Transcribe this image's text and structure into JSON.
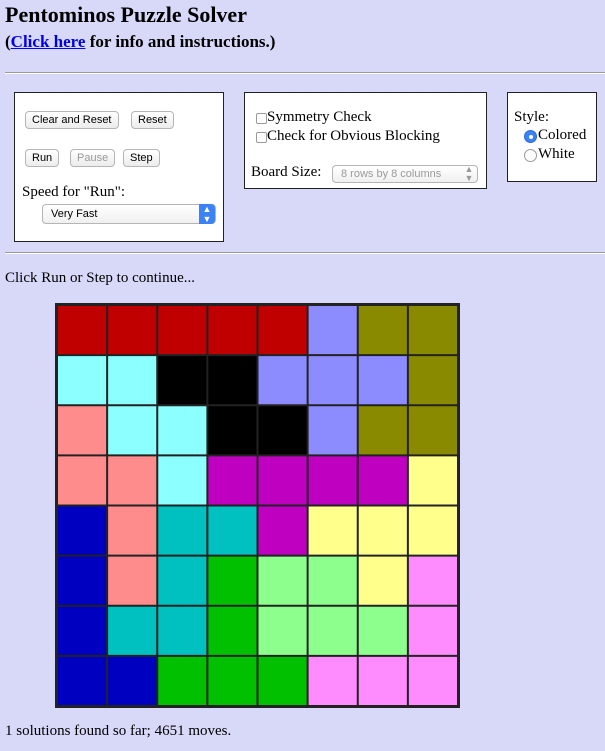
{
  "header": {
    "title": "Pentominos Puzzle Solver",
    "info_link": "Click here",
    "info_rest": " for info and instructions.)"
  },
  "controls": {
    "clear_reset": "Clear and Reset",
    "reset": "Reset",
    "run": "Run",
    "pause": "Pause",
    "step": "Step",
    "speed_label": "Speed for \"Run\":",
    "speed_value": "Very Fast"
  },
  "options": {
    "symmetry_check": "Symmetry Check",
    "blocking_check": "Check for Obvious Blocking",
    "board_size_label": "Board Size:",
    "board_size_value": "8 rows by 8 columns"
  },
  "style": {
    "label": "Style:",
    "colored": "Colored",
    "white": "White",
    "selected": "Colored"
  },
  "status": {
    "message": "Click Run or Step to continue...",
    "result": "1 solutions found so far; 4651 moves."
  },
  "board": {
    "rows": 8,
    "cols": 8,
    "colors": {
      "A": "#c00000",
      "B": "#8c8cff",
      "C": "#8a8a00",
      "D": "#8cffff",
      "E": "#000000",
      "F": "#ff8c8c",
      "G": "#c000c0",
      "H": "#ffff8c",
      "I": "#0000c0",
      "J": "#00c0c0",
      "K": "#00c000",
      "L": "#8cff8c",
      "M": "#ff8cff"
    },
    "cells": [
      "AAAAABCC",
      "DDEEBBBC",
      "FDDEEBCC",
      "FFDGGGGH",
      "IFJJGHHH",
      "IFJKLLHM",
      "IJJKLLLM",
      "IIKKKMMM"
    ]
  }
}
